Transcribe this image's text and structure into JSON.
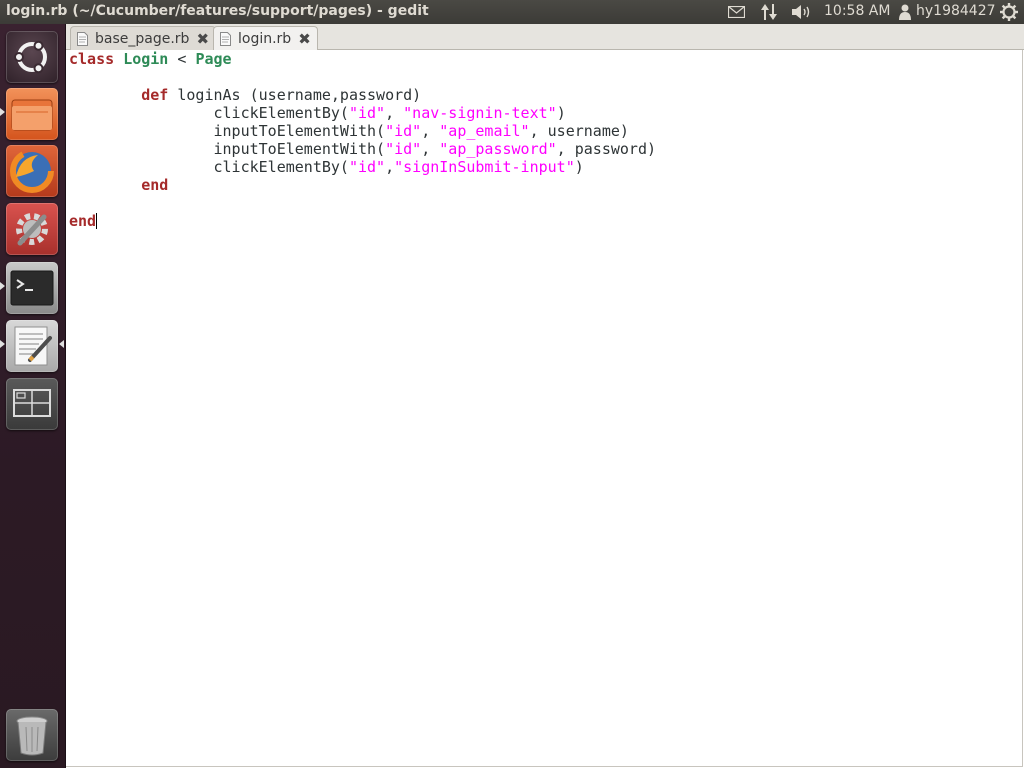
{
  "window": {
    "title": "login.rb (~/Cucumber/features/support/pages) - gedit"
  },
  "top_panel": {
    "clock": "10:58 AM",
    "user": "hy1984427",
    "icons": [
      "mail-icon",
      "network-icon",
      "sound-icon",
      "user-icon",
      "gear-icon"
    ]
  },
  "launcher": {
    "items": [
      "ubuntu-dash",
      "files",
      "firefox",
      "system-settings",
      "terminal",
      "text-editor",
      "workspace-switcher",
      "trash"
    ]
  },
  "tabs": [
    {
      "label": "base_page.rb",
      "active": false
    },
    {
      "label": "login.rb",
      "active": true
    }
  ],
  "code": {
    "l1": {
      "kw_class": "class",
      "name": "Login",
      "op": " < ",
      "parent": "Page"
    },
    "l3": {
      "indent": "        ",
      "kw_def": "def",
      "rest": " loginAs (username,password)"
    },
    "l4": {
      "a": "                clickElementBy(",
      "s1": "\"id\"",
      "b": ", ",
      "s2": "\"nav-signin-text\"",
      "c": ")"
    },
    "l5": {
      "a": "                inputToElementWith(",
      "s1": "\"id\"",
      "b": ", ",
      "s2": "\"ap_email\"",
      "c": ", username)"
    },
    "l6": {
      "a": "                inputToElementWith(",
      "s1": "\"id\"",
      "b": ", ",
      "s2": "\"ap_password\"",
      "c": ", password)"
    },
    "l7": {
      "a": "                clickElementBy(",
      "s1": "\"id\"",
      "b": ",",
      "s2": "\"signInSubmit-input\"",
      "c": ")"
    },
    "l8": {
      "indent": "        ",
      "kw_end": "end"
    },
    "l10": {
      "kw_end": "end"
    }
  }
}
